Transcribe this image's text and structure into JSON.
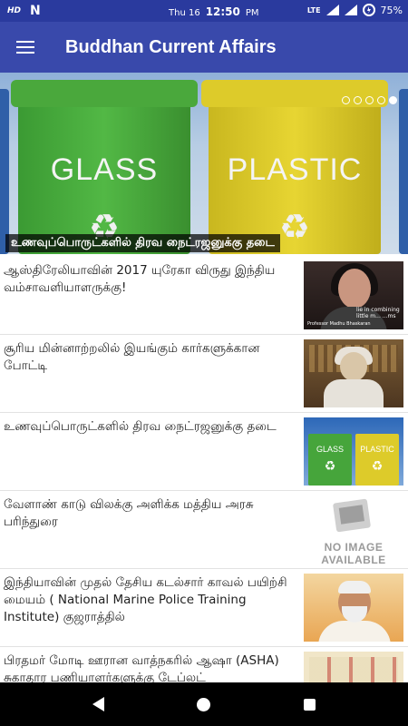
{
  "status_bar": {
    "hd": "HD",
    "carrier_icon": "N",
    "date": "Thu 16",
    "time": "12:50",
    "ampm": "PM",
    "network": "LTE",
    "battery": "75%"
  },
  "app_bar": {
    "title": "Buddhan Current Affairs",
    "menu_icon": "hamburger-menu-icon"
  },
  "carousel": {
    "caption": "உணவுப்பொருட்களில் திரவ நைட்ரஜனுக்கு தடை",
    "bin_labels": [
      "GLASS",
      "PLASTIC"
    ],
    "dots_total": 5,
    "active_dot": 4
  },
  "news": [
    {
      "title": "ஆஸ்திரேலியாவின் 2017 யுரேகா விருது இந்திய வம்சாவளியாளருக்கு!",
      "thumb": "woman",
      "subtitle": "lie in combining little m... ...ms",
      "credit": "Professor Madhu Bhaskaran"
    },
    {
      "title": "சூரிய மின்னாற்றலில் இயங்கும் கார்களுக்கான போட்டி",
      "thumb": "kalam"
    },
    {
      "title": "உணவுப்பொருட்களில் திரவ நைட்ரஜனுக்கு தடை",
      "thumb": "bins",
      "labels": [
        "GLASS",
        "PLASTIC"
      ]
    },
    {
      "title": "வேளாண் காடு விலக்கு அளிக்க மத்திய அரசு பரிந்துரை",
      "thumb": "noimg",
      "noimg_text": "NO IMAGE AVAILABLE"
    },
    {
      "title": "இந்தியாவின் முதல் தேசிய கடல்சார் காவல் பயிற்சி மையம் ( National Marine Police Training Institute) குஜராத்தில்",
      "thumb": "modi"
    },
    {
      "title": "பிரதமர் மோடி ஊரான வாத்நகரில் ஆஷா (ASHA) சுகாதார பணியாளர்களுக்கு டேப்லட்",
      "thumb": "app"
    }
  ],
  "nav": {
    "back": "back-icon",
    "home": "home-icon",
    "recents": "recents-icon"
  }
}
